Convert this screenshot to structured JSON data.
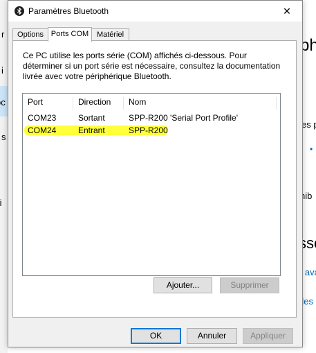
{
  "window": {
    "title": "Paramètres Bluetooth",
    "close_glyph": "✕"
  },
  "tabs": [
    {
      "label": "Options"
    },
    {
      "label": "Ports COM"
    },
    {
      "label": "Matériel"
    }
  ],
  "description": "Ce PC utilise les ports série (COM) affichés ci-dessous. Pour déterminer si un port série est nécessaire, consultez la documentation livrée avec votre périphérique Bluetooth.",
  "list": {
    "headers": [
      "Port",
      "Direction",
      "Nom"
    ],
    "rows": [
      {
        "port": "COM23",
        "direction": "Sortant",
        "name": "SPP-R200 'Serial Port Profile'",
        "highlighted": false
      },
      {
        "port": "COM24",
        "direction": "Entrant",
        "name": "SPP-R200",
        "highlighted": true
      }
    ],
    "highlight_color": "#ffff3a"
  },
  "panel_buttons": {
    "add": "Ajouter...",
    "remove": "Supprimer"
  },
  "footer_buttons": {
    "ok": "OK",
    "cancel": "Annuler",
    "apply": "Appliquer"
  },
  "background_fragments": {
    "left": [
      "r",
      "i",
      "oc",
      "s",
      "ti"
    ],
    "right": [
      "ph",
      "es p",
      "•",
      "nib",
      "ssc",
      "n ava",
      "des"
    ]
  },
  "colors": {
    "accent": "#0078d7",
    "link": "#0063b1"
  }
}
